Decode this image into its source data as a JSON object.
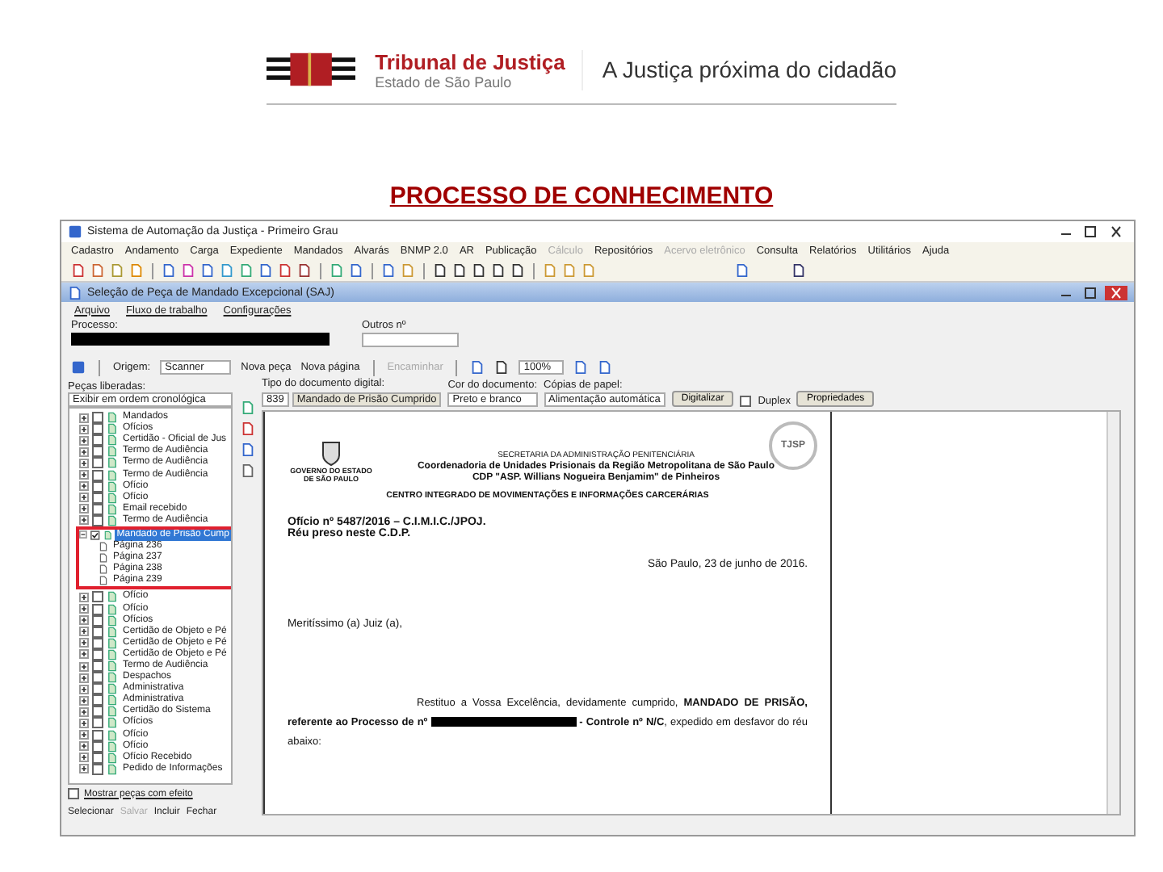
{
  "slide": {
    "org_name": "Tribunal de Justiça",
    "org_subtitle": "Estado de São Paulo",
    "tagline": "A Justiça próxima do cidadão",
    "title": "PROCESSO DE CONHECIMENTO"
  },
  "window": {
    "title": "Sistema de Automação da Justiça - Primeiro Grau"
  },
  "menu": [
    {
      "label": "Cadastro",
      "disabled": false
    },
    {
      "label": "Andamento",
      "disabled": false
    },
    {
      "label": "Carga",
      "disabled": false
    },
    {
      "label": "Expediente",
      "disabled": false
    },
    {
      "label": "Mandados",
      "disabled": false
    },
    {
      "label": "Alvarás",
      "disabled": false
    },
    {
      "label": "BNMP 2.0",
      "disabled": false
    },
    {
      "label": "AR",
      "disabled": false
    },
    {
      "label": "Publicação",
      "disabled": false
    },
    {
      "label": "Cálculo",
      "disabled": true
    },
    {
      "label": "Repositórios",
      "disabled": false
    },
    {
      "label": "Acervo eletrônico",
      "disabled": true
    },
    {
      "label": "Consulta",
      "disabled": false
    },
    {
      "label": "Relatórios",
      "disabled": false
    },
    {
      "label": "Utilitários",
      "disabled": false
    },
    {
      "label": "Ajuda",
      "disabled": false
    }
  ],
  "dialog": {
    "title": "Seleção de Peça de Mandado Excepcional (SAJ)",
    "menu": [
      "Arquivo",
      "Fluxo de trabalho",
      "Configurações"
    ],
    "process_label": "Processo:",
    "others_label": "Outros nº",
    "origin_label": "Origem:",
    "origin_value": "Scanner",
    "new_piece": "Nova peça",
    "new_page": "Nova página",
    "forward": "Encaminhar",
    "zoom": "100%"
  },
  "pieces": {
    "label": "Peças liberadas:",
    "order": "Exibir em ordem cronológica",
    "items": [
      {
        "label": "Mandados",
        "checked": false,
        "expanded": false,
        "selected": false,
        "highlighted": false
      },
      {
        "label": "Ofícios",
        "checked": false,
        "expanded": false,
        "selected": false,
        "highlighted": false
      },
      {
        "label": "Certidão - Oficial de Jus",
        "checked": false,
        "expanded": false,
        "selected": false,
        "highlighted": false
      },
      {
        "label": "Termo de Audiência",
        "checked": false,
        "expanded": false,
        "selected": false,
        "highlighted": false
      },
      {
        "label": "Termo de Audiência",
        "checked": false,
        "expanded": false,
        "selected": false,
        "highlighted": false
      },
      {
        "label": "Termo de Audiência",
        "checked": false,
        "expanded": false,
        "selected": false,
        "highlighted": false
      },
      {
        "label": "Ofício",
        "checked": false,
        "expanded": false,
        "selected": false,
        "highlighted": false
      },
      {
        "label": "Ofício",
        "checked": false,
        "expanded": false,
        "selected": false,
        "highlighted": false
      },
      {
        "label": "Email recebido",
        "checked": false,
        "expanded": false,
        "selected": false,
        "highlighted": false
      },
      {
        "label": "Termo de Audiência",
        "checked": false,
        "expanded": false,
        "selected": false,
        "highlighted": false
      },
      {
        "label": "Mandado de Prisão Cump",
        "checked": true,
        "expanded": true,
        "selected": true,
        "highlighted": true,
        "children": [
          "Página 236",
          "Página 237",
          "Página 238",
          "Página 239"
        ]
      },
      {
        "label": "Ofício",
        "checked": false,
        "expanded": false,
        "selected": false,
        "highlighted": false
      },
      {
        "label": "Ofício",
        "checked": false,
        "expanded": false,
        "selected": false,
        "highlighted": false
      },
      {
        "label": "Ofícios",
        "checked": false,
        "expanded": false,
        "selected": false,
        "highlighted": false
      },
      {
        "label": "Certidão de Objeto e Pé",
        "checked": false,
        "expanded": false,
        "selected": false,
        "highlighted": false
      },
      {
        "label": "Certidão de Objeto e Pé",
        "checked": false,
        "expanded": false,
        "selected": false,
        "highlighted": false
      },
      {
        "label": "Certidão de Objeto e Pé",
        "checked": false,
        "expanded": false,
        "selected": false,
        "highlighted": false
      },
      {
        "label": "Termo de Audiência",
        "checked": false,
        "expanded": false,
        "selected": false,
        "highlighted": false
      },
      {
        "label": "Despachos",
        "checked": false,
        "expanded": false,
        "selected": false,
        "highlighted": false
      },
      {
        "label": "Administrativa",
        "checked": false,
        "expanded": false,
        "selected": false,
        "highlighted": false
      },
      {
        "label": "Administrativa",
        "checked": false,
        "expanded": false,
        "selected": false,
        "highlighted": false
      },
      {
        "label": "Certidão do Sistema",
        "checked": false,
        "expanded": false,
        "selected": false,
        "highlighted": false
      },
      {
        "label": "Ofícios",
        "checked": false,
        "expanded": false,
        "selected": false,
        "highlighted": false
      },
      {
        "label": "Ofício",
        "checked": false,
        "expanded": false,
        "selected": false,
        "highlighted": false
      },
      {
        "label": "Ofício",
        "checked": false,
        "expanded": false,
        "selected": false,
        "highlighted": false
      },
      {
        "label": "Ofício Recebido",
        "checked": false,
        "expanded": false,
        "selected": false,
        "highlighted": false
      },
      {
        "label": "Pedido de Informações",
        "checked": false,
        "expanded": false,
        "selected": false,
        "highlighted": false
      }
    ],
    "show_option": {
      "label": "Mostrar peças com efeito",
      "checked": false
    }
  },
  "footer_buttons": [
    {
      "label": "Selecionar",
      "disabled": false
    },
    {
      "label": "Salvar",
      "disabled": true
    },
    {
      "label": "Incluir",
      "disabled": false
    },
    {
      "label": "Fechar",
      "disabled": false
    }
  ],
  "properties": {
    "type_label": "Tipo do documento digital:",
    "type_code": "839",
    "type_value": "Mandado de Prisão Cumprido",
    "color_label": "Cor do documento:",
    "color_value": "Preto e branco",
    "paper_label": "Cópias de papel:",
    "paper_value": "Alimentação automática",
    "scan_button": "Digitalizar",
    "duplex": {
      "label": "Duplex",
      "checked": false
    },
    "properties_button": "Propriedades"
  },
  "document": {
    "emblem_caption": "GOVERNO DO ESTADO DE SÃO PAULO",
    "stamp": "TJSP",
    "header": [
      "SECRETARIA DA ADMINISTRAÇÃO PENITENCIÁRIA",
      "Coordenadoria de Unidades Prisionais da Região Metropolitana de São Paulo",
      "CDP \"ASP. Willians Nogueira Benjamim\" de Pinheiros"
    ],
    "center": "CENTRO INTEGRADO DE MOVIMENTAÇÕES E INFORMAÇÕES CARCERÁRIAS",
    "ref": [
      "Ofício nº 5487/2016 – C.I.M.I.C./JPOJ.",
      "Réu preso neste C.D.P."
    ],
    "date": "São Paulo, 23 de junho de 2016.",
    "salutation": "Meritíssimo (a) Juiz (a),",
    "body_start": "Restituo a Vossa Excelência, devidamente cumprido, **MANDADO DE PRISÃO, referente ao Processo de nº**",
    "body_end": "**- Controle nº N/C**, expedido em desfavor do réu abaixo:"
  }
}
